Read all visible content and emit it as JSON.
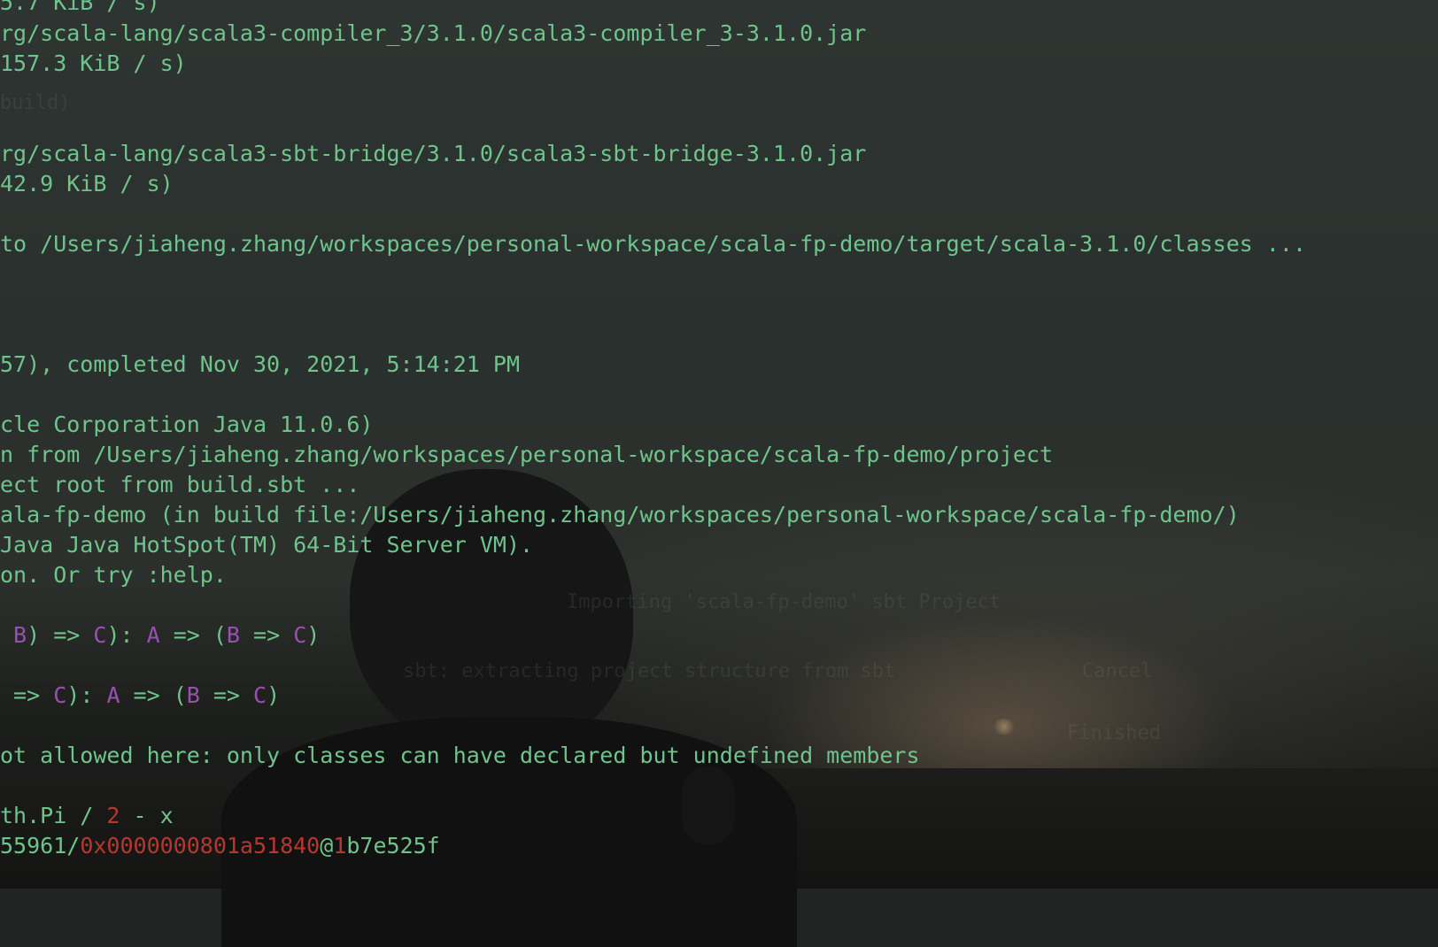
{
  "terminal": {
    "lines": [
      "5.7 KiB / s)",
      "rg/scala-lang/scala3-compiler_3/3.1.0/scala3-compiler_3-3.1.0.jar",
      "157.3 KiB / s)",
      "rg/scala-lang/scala3-sbt-bridge/3.1.0/scala3-sbt-bridge-3.1.0.jar",
      "42.9 KiB / s)",
      "to /Users/jiaheng.zhang/workspaces/personal-workspace/scala-fp-demo/target/scala-3.1.0/classes ...",
      "57), completed Nov 30, 2021, 5:14:21 PM",
      "cle Corporation Java 11.0.6)",
      "n from /Users/jiaheng.zhang/workspaces/personal-workspace/scala-fp-demo/project",
      "ect root from build.sbt ...",
      "ala-fp-demo (in build file:/Users/jiaheng.zhang/workspaces/personal-workspace/scala-fp-demo/)",
      "Java Java HotSpot(TM) 64-Bit Server VM).",
      "on. Or try :help.",
      "ot allowed here: only classes can have declared but undefined members"
    ],
    "sig1": {
      "p1": " B",
      "t1": ") => ",
      "p2": "C",
      "t2": "): ",
      "p3": "A",
      "t3": " => (",
      "p4": "B",
      "t4": " => ",
      "p5": "C",
      "t5": ")"
    },
    "sig2": {
      "t0": " => ",
      "p1": "C",
      "t1": "): ",
      "p2": "A",
      "t2": " => (",
      "p3": "B",
      "t3": " => ",
      "p4": "C",
      "t4": ")"
    },
    "expr": {
      "t1": "th.Pi / ",
      "r1": "2",
      "t2": " - x"
    },
    "obj": {
      "t1": "55961/",
      "r1": "0x0000000801a51840",
      "t2": "@",
      "r2": "1",
      "t3": "b7e525f"
    },
    "faint": [
      "build)",
      "Importing 'scala-fp-demo' sbt Project",
      "sbt: extracting project structure from sbt",
      "Cancel",
      "Finished"
    ]
  }
}
